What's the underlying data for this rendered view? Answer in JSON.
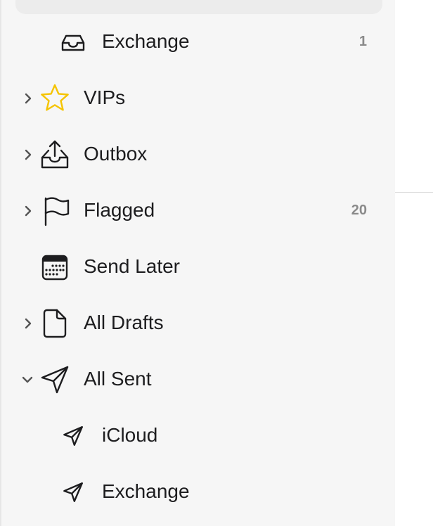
{
  "mailboxes": [
    {
      "id": "exchange-inbox",
      "label": "Exchange",
      "count": "1",
      "icon": "tray-icon",
      "indent": "sub",
      "chevron": "none"
    },
    {
      "id": "vips",
      "label": "VIPs",
      "count": "",
      "icon": "star-icon",
      "indent": "main",
      "chevron": "right"
    },
    {
      "id": "outbox",
      "label": "Outbox",
      "count": "",
      "icon": "outbox-tray-icon",
      "indent": "main",
      "chevron": "right"
    },
    {
      "id": "flagged",
      "label": "Flagged",
      "count": "20",
      "icon": "flag-icon",
      "indent": "main",
      "chevron": "right"
    },
    {
      "id": "send-later",
      "label": "Send Later",
      "count": "",
      "icon": "calendar-icon",
      "indent": "main",
      "chevron": "none"
    },
    {
      "id": "all-drafts",
      "label": "All Drafts",
      "count": "",
      "icon": "document-icon",
      "indent": "main",
      "chevron": "right"
    },
    {
      "id": "all-sent",
      "label": "All Sent",
      "count": "",
      "icon": "paper-plane-icon",
      "indent": "main",
      "chevron": "down"
    },
    {
      "id": "sent-icloud",
      "label": "iCloud",
      "count": "",
      "icon": "paper-plane-icon",
      "indent": "sub",
      "chevron": "none"
    },
    {
      "id": "sent-exchange",
      "label": "Exchange",
      "count": "",
      "icon": "paper-plane-icon",
      "indent": "sub",
      "chevron": "none"
    }
  ],
  "colors": {
    "star": "#f5c400",
    "text": "#1d1d1f",
    "count": "#8a8a8a",
    "sidebar_bg": "#f6f6f6"
  }
}
